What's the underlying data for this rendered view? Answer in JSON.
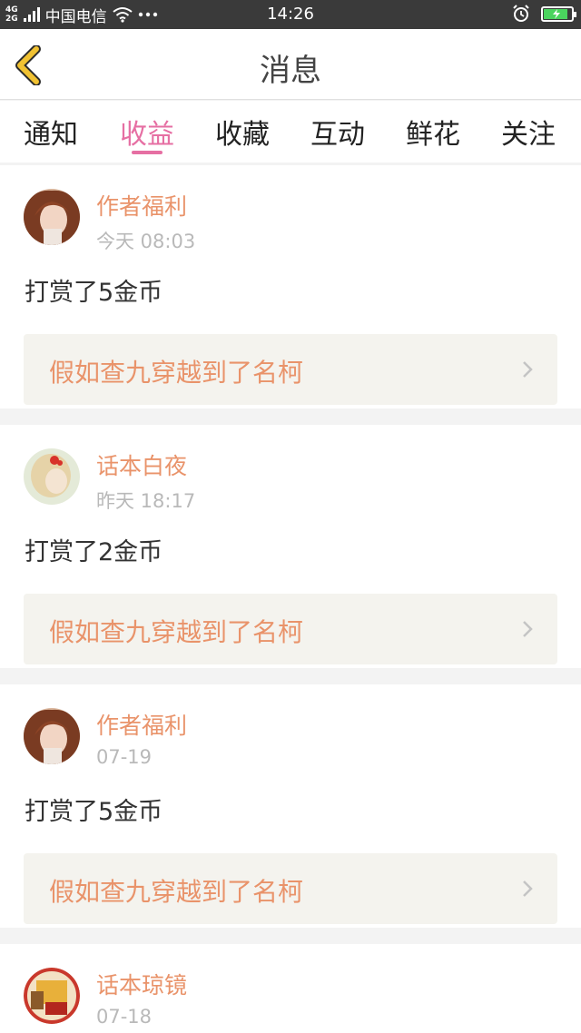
{
  "status_bar": {
    "network_top": "4G",
    "network_bottom": "2G",
    "carrier": "中国电信",
    "time": "14:26"
  },
  "header": {
    "title": "消息"
  },
  "tabs": [
    {
      "label": "通知"
    },
    {
      "label": "收益"
    },
    {
      "label": "收藏"
    },
    {
      "label": "互动"
    },
    {
      "label": "鲜花"
    },
    {
      "label": "关注"
    }
  ],
  "active_tab": "收益",
  "messages": [
    {
      "author": "作者福利",
      "time": "今天 08:03",
      "text": "打赏了5金币",
      "book": "假如查九穿越到了名柯"
    },
    {
      "author": "话本白夜",
      "time": "昨天 18:17",
      "text": "打赏了2金币",
      "book": "假如查九穿越到了名柯"
    },
    {
      "author": "作者福利",
      "time": "07-19",
      "text": "打赏了5金币",
      "book": "假如查九穿越到了名柯"
    },
    {
      "author": "话本琼镜",
      "time": "07-18"
    }
  ],
  "colors": {
    "accent": "#e66fa3",
    "author": "#e9936a",
    "back_icon": "#f1c232",
    "battery": "#4ad35e"
  }
}
